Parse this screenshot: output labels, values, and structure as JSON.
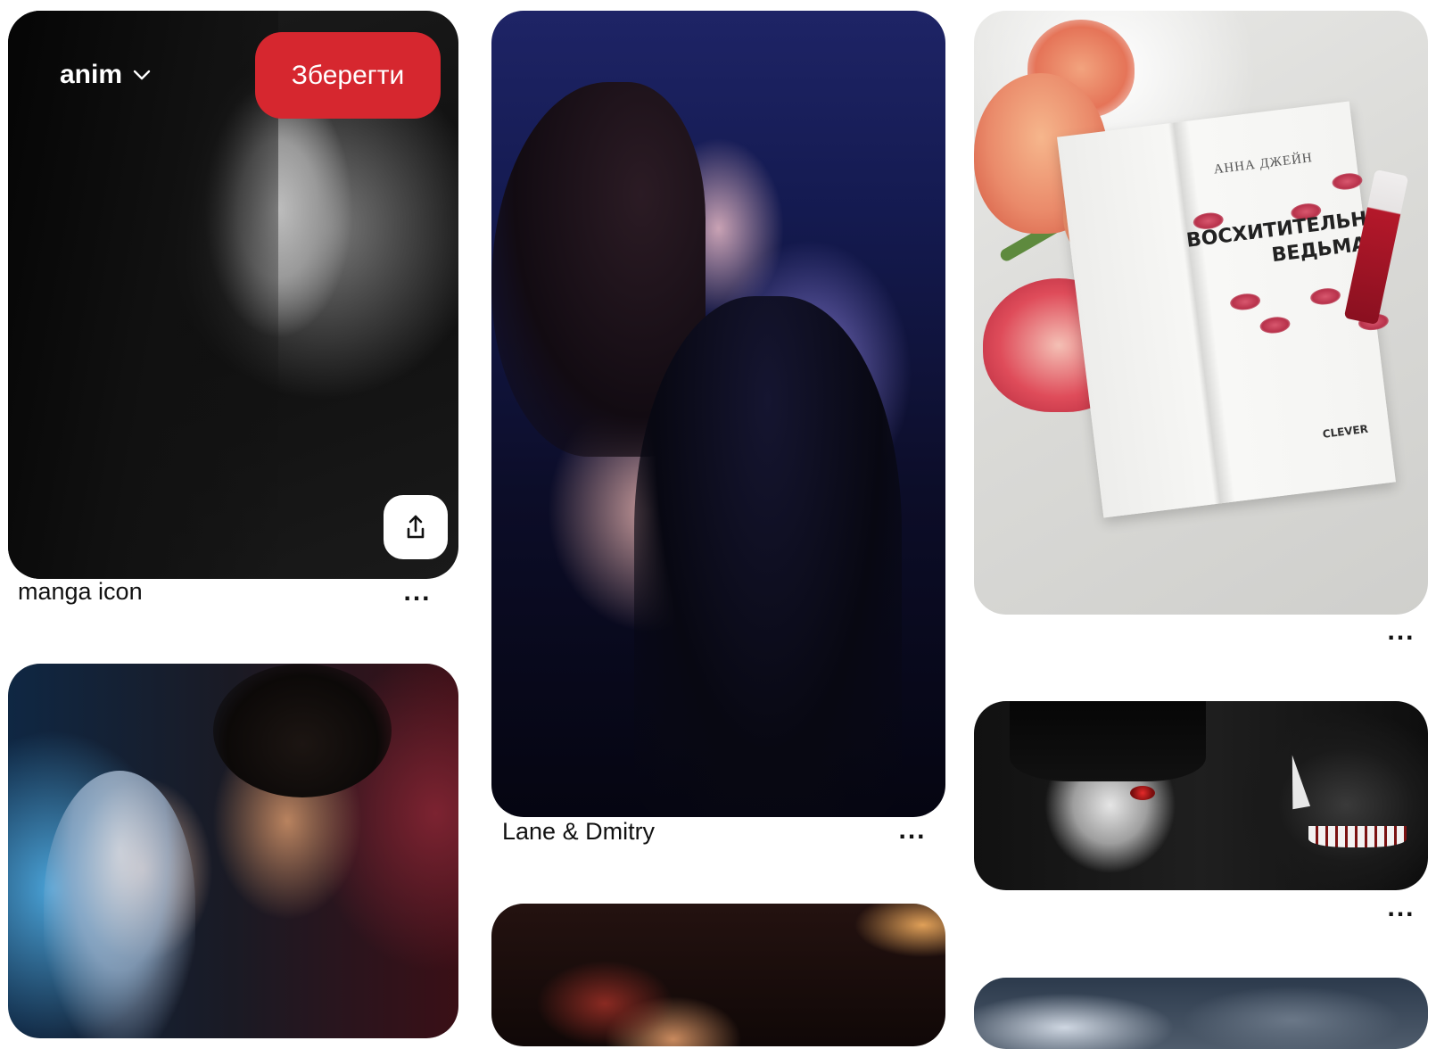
{
  "colors": {
    "save_button": "#d6272f",
    "text": "#111111",
    "background": "#ffffff"
  },
  "hover_overlay": {
    "board_name": "anim",
    "board_chevron_icon": "chevron-down-icon",
    "save_label": "Зберегти",
    "share_icon": "share-upload-icon"
  },
  "pins": [
    {
      "id": "pin1",
      "title": "manga icon",
      "more_label": "..."
    },
    {
      "id": "pin2",
      "title": "",
      "more_label": ""
    },
    {
      "id": "pin3",
      "title": "Lane & Dmitry",
      "more_label": "..."
    },
    {
      "id": "pin4",
      "title": "",
      "more_label": ""
    },
    {
      "id": "pin5",
      "title": "",
      "more_label": "...",
      "image_text": {
        "author": "АННА ДЖЕЙН",
        "book_title": "ВОСХИТИТЕЛЬНАЯ ВЕДЬМА",
        "publisher": "CLEVER"
      }
    },
    {
      "id": "pin6",
      "title": "",
      "more_label": "..."
    },
    {
      "id": "pin7",
      "title": "",
      "more_label": ""
    }
  ]
}
